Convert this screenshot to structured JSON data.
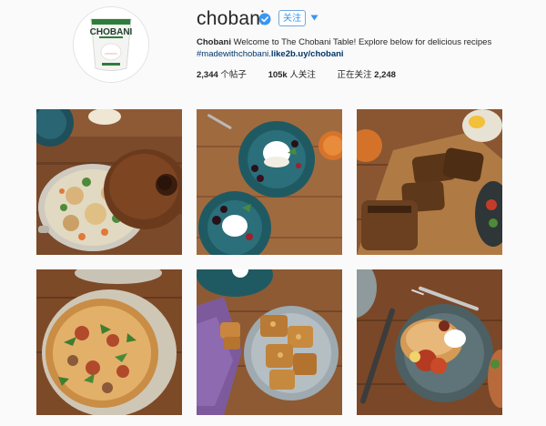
{
  "profile": {
    "username": "chobani",
    "follow_label": "关注",
    "avatar_logo": "CHOBANI",
    "bio": {
      "name": "Chobani",
      "text": " Welcome to The Chobani Table! Explore below for delicious recipes",
      "hashtag": "#madewithchobani.",
      "link": "like2b.uy/chobani"
    },
    "stats": {
      "posts_count": "2,344",
      "posts_label": "个帖子",
      "followers_count": "105k",
      "followers_label": "人关注",
      "following_label": "正在关注",
      "following_count": "2,248"
    }
  },
  "posts": [
    {
      "subject": "roast chicken casserole with lid"
    },
    {
      "subject": "yogurt with berries on teal plates"
    },
    {
      "subject": "sliced banana bread loaf"
    },
    {
      "subject": "flatbread pizza with arugula"
    },
    {
      "subject": "squares of baked dessert bars"
    },
    {
      "subject": "pancake with fruit and fork"
    }
  ],
  "colors": {
    "accent": "#3897f0",
    "link": "#003569",
    "background": "#fafafa",
    "wood": "#8a5631"
  }
}
